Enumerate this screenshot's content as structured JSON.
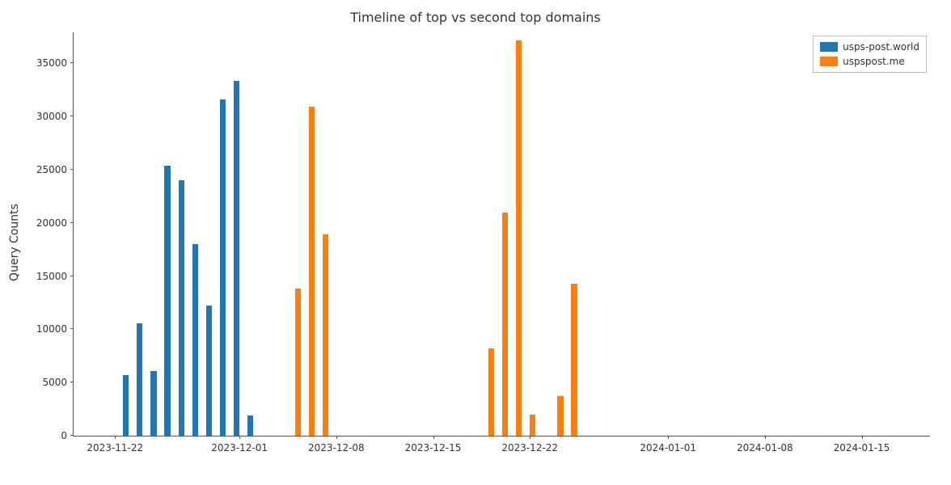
{
  "chart_data": {
    "type": "bar",
    "title": "Timeline of top vs second top domains",
    "xlabel": "",
    "ylabel": "Query Counts",
    "ylim": [
      0,
      38000
    ],
    "yticks": [
      0,
      5000,
      10000,
      15000,
      20000,
      25000,
      30000,
      35000
    ],
    "xticks": [
      "2023-11-22",
      "2023-12-01",
      "2023-12-08",
      "2023-12-15",
      "2023-12-22",
      "2024-01-01",
      "2024-01-08",
      "2024-01-15"
    ],
    "x_start": "2023-11-19",
    "x_end": "2024-01-20",
    "series": [
      {
        "name": "usps-post.world",
        "color": "#1f77b4",
        "points": [
          {
            "date": "2023-11-23",
            "value": 5700
          },
          {
            "date": "2023-11-24",
            "value": 10600
          },
          {
            "date": "2023-11-25",
            "value": 6100
          },
          {
            "date": "2023-11-26",
            "value": 25400
          },
          {
            "date": "2023-11-27",
            "value": 24000
          },
          {
            "date": "2023-11-28",
            "value": 18000
          },
          {
            "date": "2023-11-29",
            "value": 12200
          },
          {
            "date": "2023-11-30",
            "value": 31600
          },
          {
            "date": "2023-12-01",
            "value": 33400
          },
          {
            "date": "2023-12-02",
            "value": 1900
          }
        ]
      },
      {
        "name": "uspspost.me",
        "color": "#ff7f0e",
        "points": [
          {
            "date": "2023-12-05",
            "value": 13800
          },
          {
            "date": "2023-12-06",
            "value": 30900
          },
          {
            "date": "2023-12-07",
            "value": 18900
          },
          {
            "date": "2023-12-19",
            "value": 8200
          },
          {
            "date": "2023-12-20",
            "value": 21000
          },
          {
            "date": "2023-12-21",
            "value": 37200
          },
          {
            "date": "2023-12-22",
            "value": 2000
          },
          {
            "date": "2023-12-24",
            "value": 3700
          },
          {
            "date": "2023-12-25",
            "value": 14300
          }
        ]
      }
    ]
  }
}
